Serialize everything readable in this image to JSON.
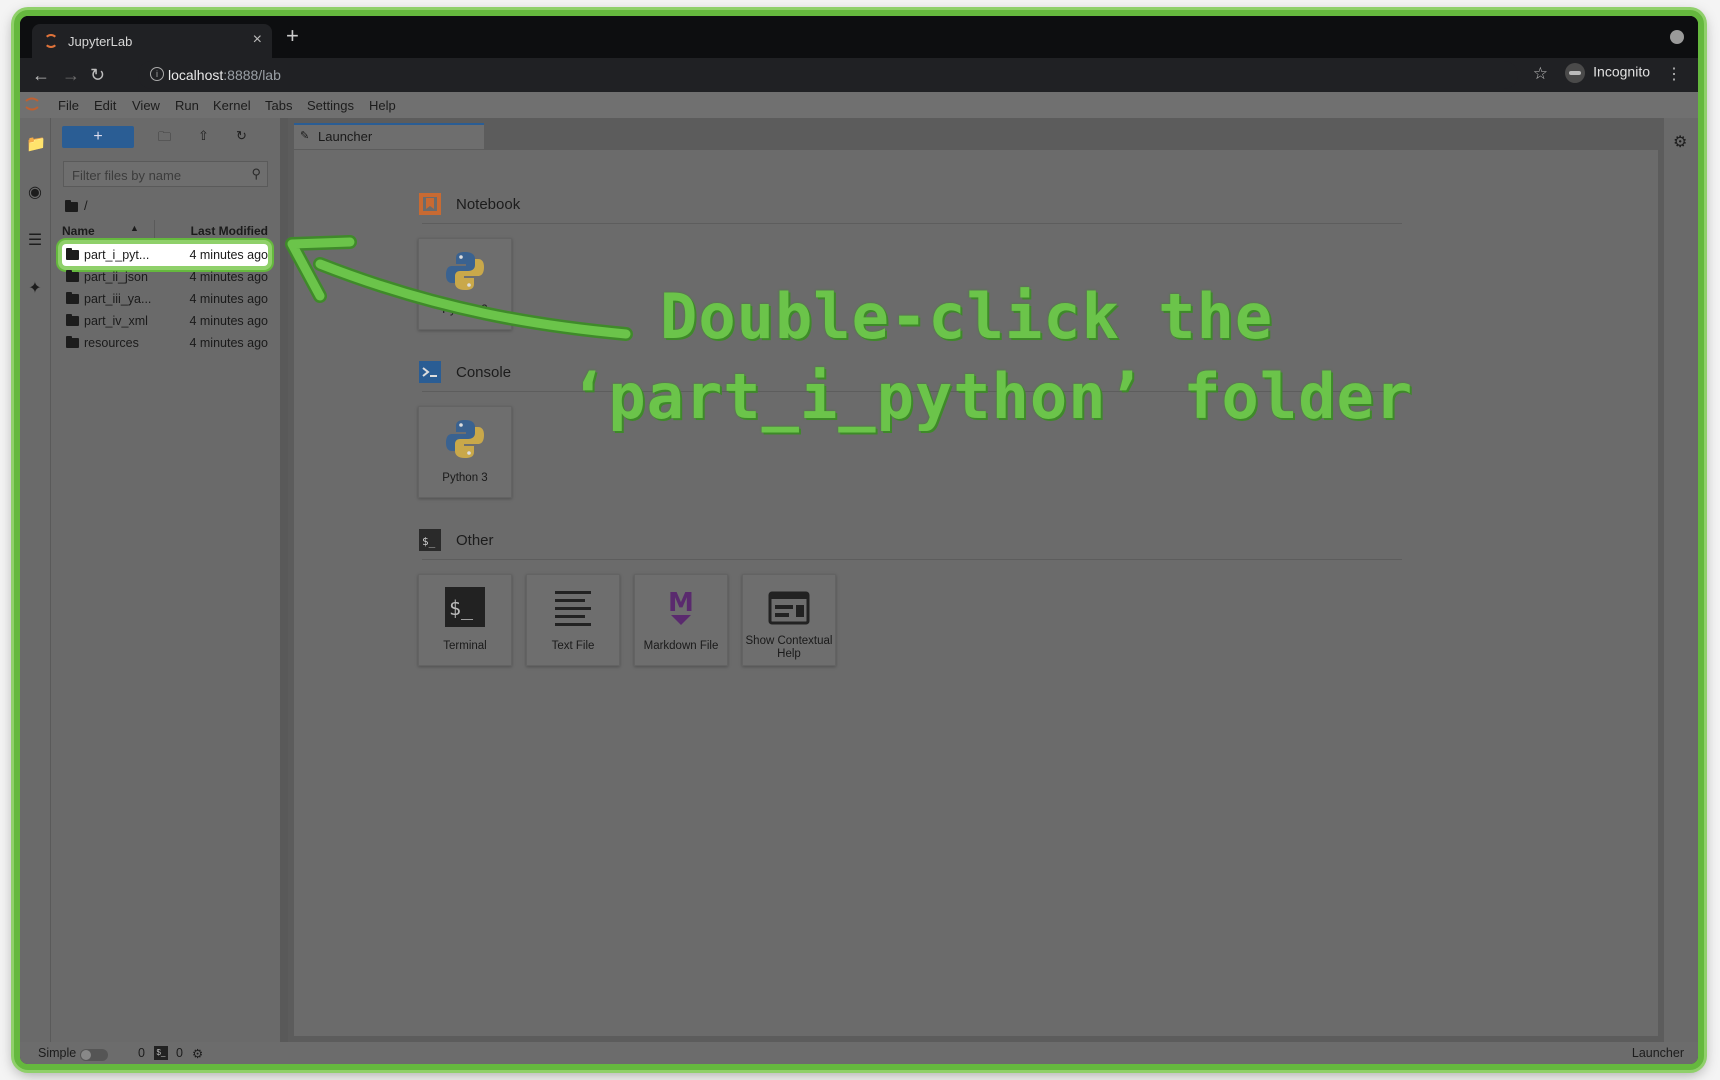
{
  "browser": {
    "tab_title": "JupyterLab",
    "tab_close": "×",
    "new_tab": "+",
    "url_host": "localhost",
    "url_rest": ":8888/lab",
    "profile_label": "Incognito"
  },
  "menubar": {
    "items": [
      "File",
      "Edit",
      "View",
      "Run",
      "Kernel",
      "Tabs",
      "Settings",
      "Help"
    ]
  },
  "file_browser": {
    "new_label": "+",
    "filter_placeholder": "Filter files by name",
    "breadcrumb": "/",
    "col_name": "Name",
    "col_modified": "Last Modified",
    "rows": [
      {
        "name": "part_i_pyt...",
        "modified": "4 minutes ago",
        "selected": true
      },
      {
        "name": "part_ii_json",
        "modified": "4 minutes ago"
      },
      {
        "name": "part_iii_ya...",
        "modified": "4 minutes ago"
      },
      {
        "name": "part_iv_xml",
        "modified": "4 minutes ago"
      },
      {
        "name": "resources",
        "modified": "4 minutes ago"
      }
    ]
  },
  "main": {
    "tab_label": "Launcher",
    "sections": {
      "notebook": {
        "title": "Notebook",
        "cards": [
          "Python 3"
        ]
      },
      "console": {
        "title": "Console",
        "cards": [
          "Python 3"
        ]
      },
      "other": {
        "title": "Other",
        "cards": [
          "Terminal",
          "Text File",
          "Markdown File",
          "Show Contextual Help"
        ]
      }
    }
  },
  "statusbar": {
    "mode_label": "Simple",
    "count_a": "0",
    "count_b": "0",
    "right_label": "Launcher"
  },
  "annotation": {
    "line1": "Double-click the",
    "line2": "‘part_i_python’ folder"
  },
  "colors": {
    "annotation_green": "#6bc44a",
    "frame_green": "#65b83e",
    "jupyter_blue": "#2a5d94",
    "notebook_orange": "#e46e2e"
  }
}
